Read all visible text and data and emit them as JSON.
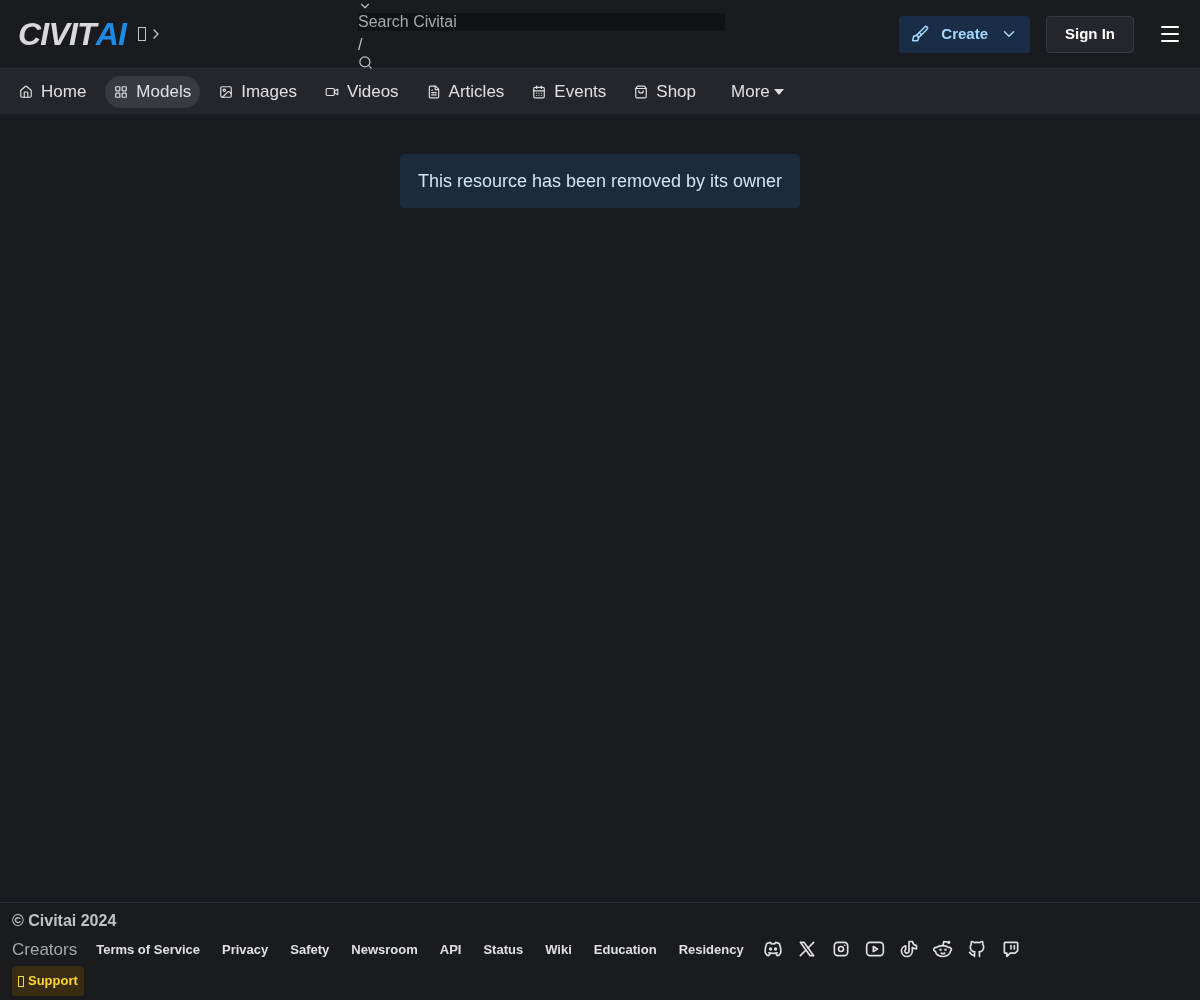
{
  "header": {
    "logo": {
      "main": "CIVIT",
      "accent": "AI"
    },
    "search": {
      "placeholder": "Search Civitai",
      "shortcut": "/"
    },
    "create_button": "Create",
    "sign_in_button": "Sign In"
  },
  "nav": [
    {
      "label": "Home",
      "selected": false
    },
    {
      "label": "Models",
      "selected": true
    },
    {
      "label": "Images",
      "selected": false
    },
    {
      "label": "Videos",
      "selected": false
    },
    {
      "label": "Articles",
      "selected": false
    },
    {
      "label": "Events",
      "selected": false
    },
    {
      "label": "Shop",
      "selected": false
    }
  ],
  "more_menu": "More",
  "alert": "This resource has been removed by its owner",
  "footer": {
    "copyright": "© Civitai 2024",
    "creators": "Creators",
    "links": [
      "Terms of Service",
      "Privacy",
      "Safety",
      "Newsroom",
      "API",
      "Status",
      "Wiki",
      "Education",
      "Residency"
    ],
    "support_button": "Support"
  }
}
